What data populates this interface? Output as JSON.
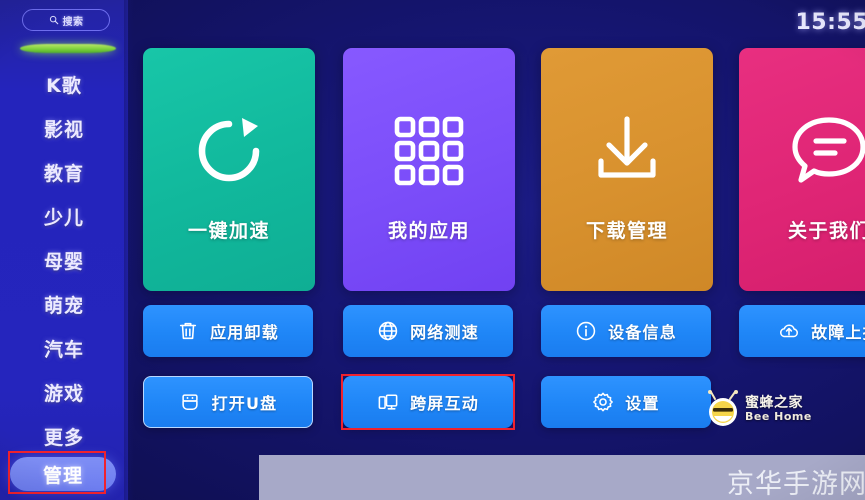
{
  "sidebar": {
    "search": {
      "label": "搜索",
      "icon": "search-icon"
    },
    "items": [
      {
        "label": "K歌"
      },
      {
        "label": "影视"
      },
      {
        "label": "教育"
      },
      {
        "label": "少儿"
      },
      {
        "label": "母婴"
      },
      {
        "label": "萌宠"
      },
      {
        "label": "汽车"
      },
      {
        "label": "游戏"
      },
      {
        "label": "更多"
      }
    ],
    "active_item": {
      "label": "管理",
      "state": "selected"
    }
  },
  "statusbar": {
    "clock": "15:55"
  },
  "tiles": [
    {
      "label": "一键加速",
      "icon": "refresh-icon",
      "color": "#11b89c"
    },
    {
      "label": "我的应用",
      "icon": "app-grid-icon",
      "color": "#7b4df9"
    },
    {
      "label": "下载管理",
      "icon": "download-icon",
      "color": "#d8912e"
    },
    {
      "label": "关于我们",
      "icon": "chat-bubble-icon",
      "color": "#df2575"
    }
  ],
  "buttons": [
    {
      "label": "应用卸载",
      "icon": "trash-icon"
    },
    {
      "label": "网络测速",
      "icon": "globe-icon"
    },
    {
      "label": "设备信息",
      "icon": "info-icon"
    },
    {
      "label": "故障上报",
      "icon": "cloud-upload-icon"
    },
    {
      "label": "打开U盘",
      "icon": "usb-drive-icon",
      "state": "focused"
    },
    {
      "label": "跨屏互动",
      "icon": "screen-cast-icon",
      "state": "annotated"
    },
    {
      "label": "设置",
      "icon": "gear-icon"
    }
  ],
  "bee_watermark": {
    "cn": "蜜蜂之家",
    "en": "Bee Home"
  },
  "site_watermark": {
    "text": "京华手游网"
  },
  "colors": {
    "background": "#15156f",
    "sidebar": "#2424bc",
    "button_blue": "#1f86f7",
    "annotation_red": "#f0222e",
    "active_pill": "#7f8ff5"
  }
}
